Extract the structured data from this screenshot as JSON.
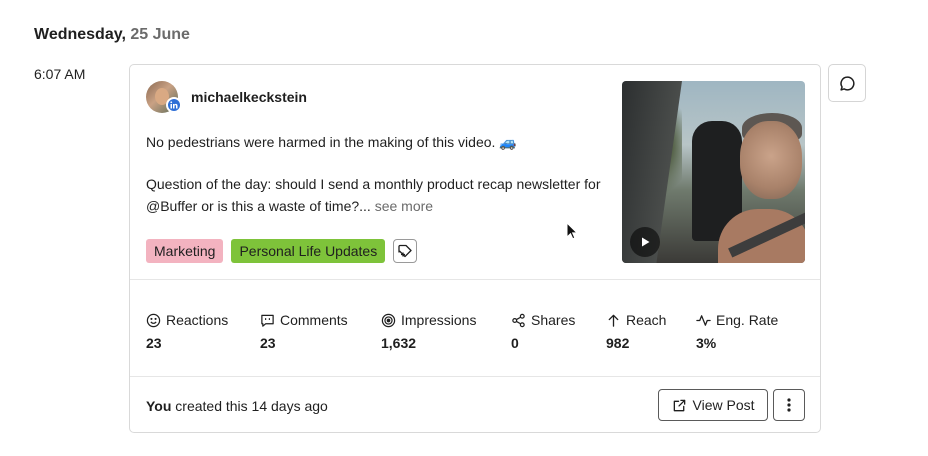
{
  "date_header": {
    "weekday": "Wednesday,",
    "day": "25 June"
  },
  "time": "6:07 AM",
  "post": {
    "username": "michaelkeckstein",
    "network_icon": "linkedin-icon",
    "text_line1": "No pedestrians were harmed in the making of this video. 🚙",
    "text_line2": "Question of the day: should I send a monthly product recap newsletter for @Buffer or is this a waste of time?...",
    "see_more": "see more",
    "tags": [
      {
        "label": "Marketing",
        "color": "#f3b3c0"
      },
      {
        "label": "Personal Life Updates",
        "color": "#7ec33a"
      }
    ],
    "media_type": "video"
  },
  "metrics": [
    {
      "label": "Reactions",
      "value": "23",
      "icon": "smile-icon"
    },
    {
      "label": "Comments",
      "value": "23",
      "icon": "comment-icon"
    },
    {
      "label": "Impressions",
      "value": "1,632",
      "icon": "target-icon"
    },
    {
      "label": "Shares",
      "value": "0",
      "icon": "share-icon"
    },
    {
      "label": "Reach",
      "value": "982",
      "icon": "arrow-up-icon"
    },
    {
      "label": "Eng. Rate",
      "value": "3%",
      "icon": "activity-icon"
    }
  ],
  "footer": {
    "created_by": "You",
    "created_text": " created this 14 days ago",
    "view_post_label": "View Post"
  }
}
